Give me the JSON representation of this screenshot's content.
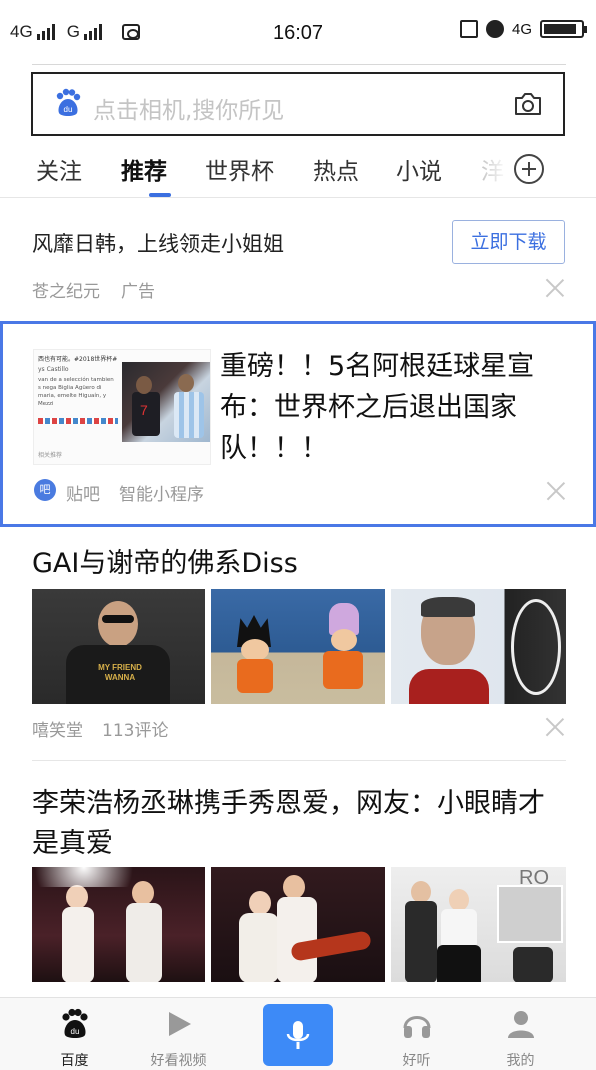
{
  "status_bar": {
    "network_left": "4G",
    "network_right": "G",
    "time": "16:07",
    "network_4g": "4G"
  },
  "search": {
    "placeholder": "点击相机,搜你所见",
    "logo_text": "du"
  },
  "tabs": [
    {
      "label": "关注",
      "active": false
    },
    {
      "label": "推荐",
      "active": true
    },
    {
      "label": "世界杯",
      "active": false
    },
    {
      "label": "热点",
      "active": false
    },
    {
      "label": "小说",
      "active": false
    },
    {
      "label": "洋",
      "active": false
    }
  ],
  "ad": {
    "title": "风靡日韩，上线领走小姐姐",
    "button": "立即下载",
    "source": "苍之纪元",
    "tag": "广告"
  },
  "highlight": {
    "title": "重磅！！5名阿根廷球星宣布：世界杯之后退出国家队！！！",
    "thumb_header": "西也有可能。#2018世界杯#",
    "thumb_author": "ys Castillo",
    "thumb_text": "van de a selección tambien s nega Biglia Agüero di maria, emelte Higuaín, y Mezzi",
    "thumb_footer": "相关推荐",
    "source_icon": "吧",
    "source": "贴吧",
    "tag": "智能小程序"
  },
  "articles": [
    {
      "title": "GAI与谢帝的佛系Diss",
      "source": "嘻笑堂",
      "comments": "113评论",
      "image_caption": "MY FRIEND WANNA"
    },
    {
      "title": "李荣浩杨丞琳携手秀恩爱，网友：小眼睛才是真爱",
      "image_caption": "RO"
    }
  ],
  "bottom_nav": [
    {
      "label": "百度",
      "icon": "baidu-paw-icon",
      "active": true
    },
    {
      "label": "好看视频",
      "icon": "play-icon",
      "active": false
    },
    {
      "label": "",
      "icon": "microphone-icon",
      "active": false
    },
    {
      "label": "好听",
      "icon": "headphones-icon",
      "active": false
    },
    {
      "label": "我的",
      "icon": "user-icon",
      "active": false
    }
  ],
  "colors": {
    "accent": "#3b6fe0",
    "highlight_border": "#4a78e6",
    "mic_button": "#3d8af7",
    "muted_text": "#999999"
  }
}
